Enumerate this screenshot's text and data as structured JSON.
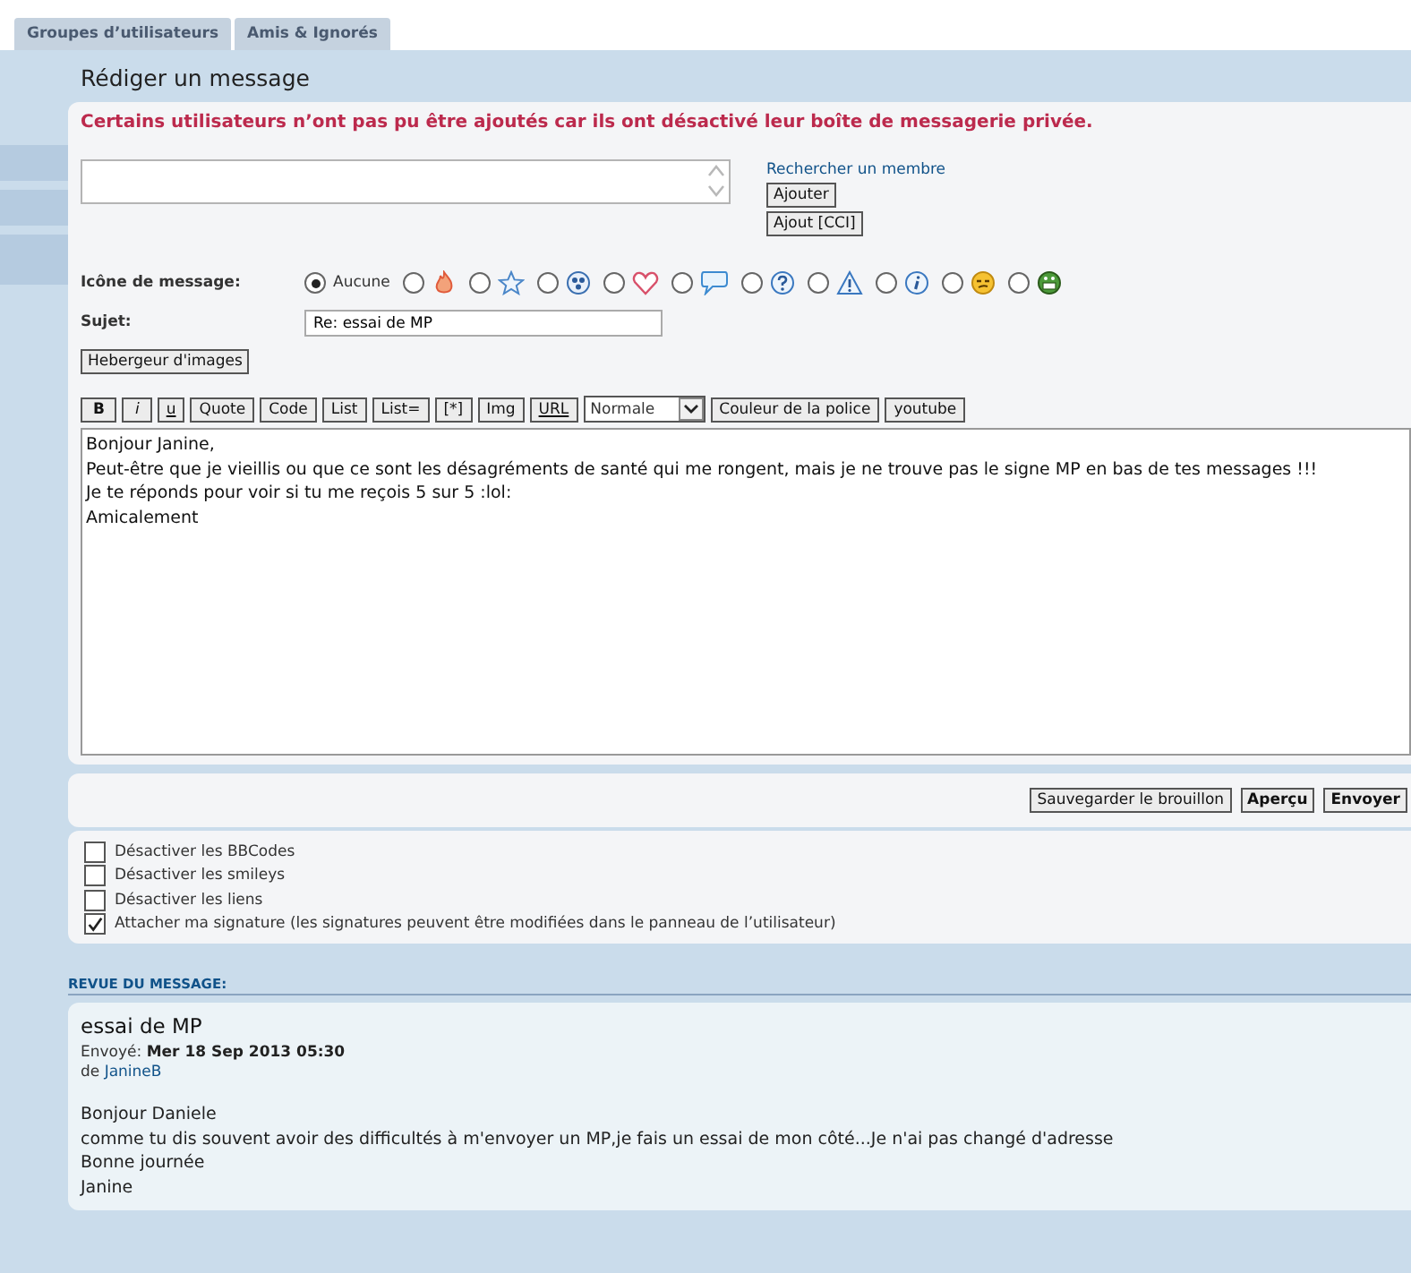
{
  "tabs": [
    {
      "label": "Groupes d’utilisateurs",
      "selected": false
    },
    {
      "label": "Amis & Ignorés",
      "selected": false
    }
  ],
  "sidebar": {
    "items": [
      {
        "selected": false
      },
      {
        "selected": false
      },
      {
        "selected": false
      }
    ]
  },
  "heading": "Rédiger un message",
  "error": "Certains utilisateurs n’ont pas pu être ajoutés car ils ont désactivé leur boîte de messagerie privée.",
  "recipients": {
    "search_link": "Rechercher un membre",
    "buttons": [
      "Ajouter",
      "Ajout [CCI]"
    ]
  },
  "message_icon": {
    "label": "Icône de message:",
    "options": [
      {
        "label": "Aucune",
        "selected": true
      },
      {
        "selected": false
      },
      {
        "selected": false
      },
      {
        "selected": false
      },
      {
        "selected": false
      },
      {
        "selected": false
      },
      {
        "selected": false
      },
      {
        "selected": false
      },
      {
        "selected": false
      },
      {
        "selected": false
      },
      {
        "selected": false
      }
    ]
  },
  "subject": {
    "label": "Sujet:",
    "value": "Re: essai de MP"
  },
  "image_host_button": "Hebergeur d'images",
  "toolbar": [
    {
      "label": "B",
      "kind": "bold"
    },
    {
      "label": "i",
      "kind": "italic"
    },
    {
      "label": "u",
      "kind": "underline"
    },
    {
      "label": "Quote",
      "kind": "plain"
    },
    {
      "label": "Code",
      "kind": "plain"
    },
    {
      "label": "List",
      "kind": "plain"
    },
    {
      "label": "List=",
      "kind": "plain"
    },
    {
      "label": "[*]",
      "kind": "plain"
    },
    {
      "label": "Img",
      "kind": "plain"
    },
    {
      "label": "URL",
      "kind": "underline"
    },
    {
      "label": "Normale",
      "kind": "select"
    },
    {
      "label": "Couleur de la police",
      "kind": "plain"
    },
    {
      "label": "youtube",
      "kind": "plain"
    }
  ],
  "message_lines": [
    "Bonjour Janine,",
    "Peut-être que je vieillis ou que ce sont les désagréments de santé qui me rongent, mais je ne trouve pas le signe MP en bas de tes messages !!!",
    "Je te réponds pour voir si tu me reçois 5 sur 5  :lol:",
    "Amicalement"
  ],
  "actions": [
    {
      "label": "Sauvegarder le brouillon",
      "kind": "plain"
    },
    {
      "label": "Aperçu",
      "kind": "bold"
    },
    {
      "label": "Envoyer",
      "kind": "bold"
    }
  ],
  "options": [
    {
      "label": "Désactiver les BBCodes",
      "checked": false
    },
    {
      "label": "Désactiver les smileys",
      "checked": false
    },
    {
      "label": "Désactiver les liens",
      "checked": false
    },
    {
      "label": "Attacher ma signature (les signatures peuvent être modifiées dans le panneau de l’utilisateur)",
      "checked": true
    }
  ],
  "review": {
    "heading": "REVUE DU MESSAGE:",
    "title": "essai de MP",
    "sent_label": "Envoyé:",
    "sent_date": "Mer 18 Sep 2013 05:30",
    "author_label": "de",
    "author": "JanineB",
    "lines": [
      "Bonjour Daniele",
      "comme tu dis souvent avoir des difficultés à m'envoyer un MP,je fais un essai de mon côté...Je n'ai pas changé d'adresse",
      "Bonne journée",
      "Janine"
    ]
  }
}
